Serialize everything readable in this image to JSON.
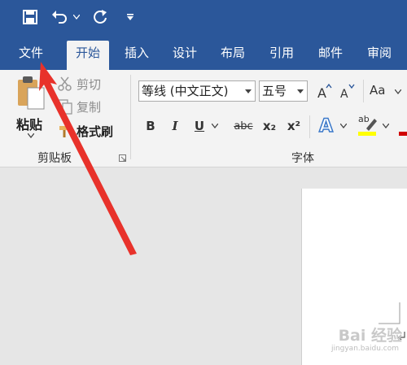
{
  "colors": {
    "brand": "#2b579a",
    "ribbon_bg": "#f3f3f3",
    "doc_bg": "#e6e6e6",
    "arrow": "#e8322b",
    "highlight_yellow": "#ffff00",
    "font_red": "#d00000"
  },
  "quick_access": {
    "save_icon": "save-icon",
    "undo_icon": "undo-icon",
    "redo_icon": "redo-icon",
    "customize_icon": "customize-icon"
  },
  "tabs": [
    {
      "label": "文件"
    },
    {
      "label": "开始",
      "active": true
    },
    {
      "label": "插入"
    },
    {
      "label": "设计"
    },
    {
      "label": "布局"
    },
    {
      "label": "引用"
    },
    {
      "label": "邮件"
    },
    {
      "label": "审阅"
    }
  ],
  "clipboard": {
    "paste_label": "粘贴",
    "cut_label": "剪切",
    "copy_label": "复制",
    "format_painter_label": "格式刷",
    "group_label": "剪贴板"
  },
  "font": {
    "font_name": "等线 (中文正文)",
    "font_size": "五号",
    "bold": "B",
    "italic": "I",
    "underline": "U",
    "strikethrough": "abc",
    "subscript": "x₂",
    "superscript": "x²",
    "change_case": "Aa",
    "highlight": "ab",
    "group_label": "字体"
  },
  "watermark": {
    "text": "Bai 经验",
    "sub": "jingyan.baidu.com"
  }
}
